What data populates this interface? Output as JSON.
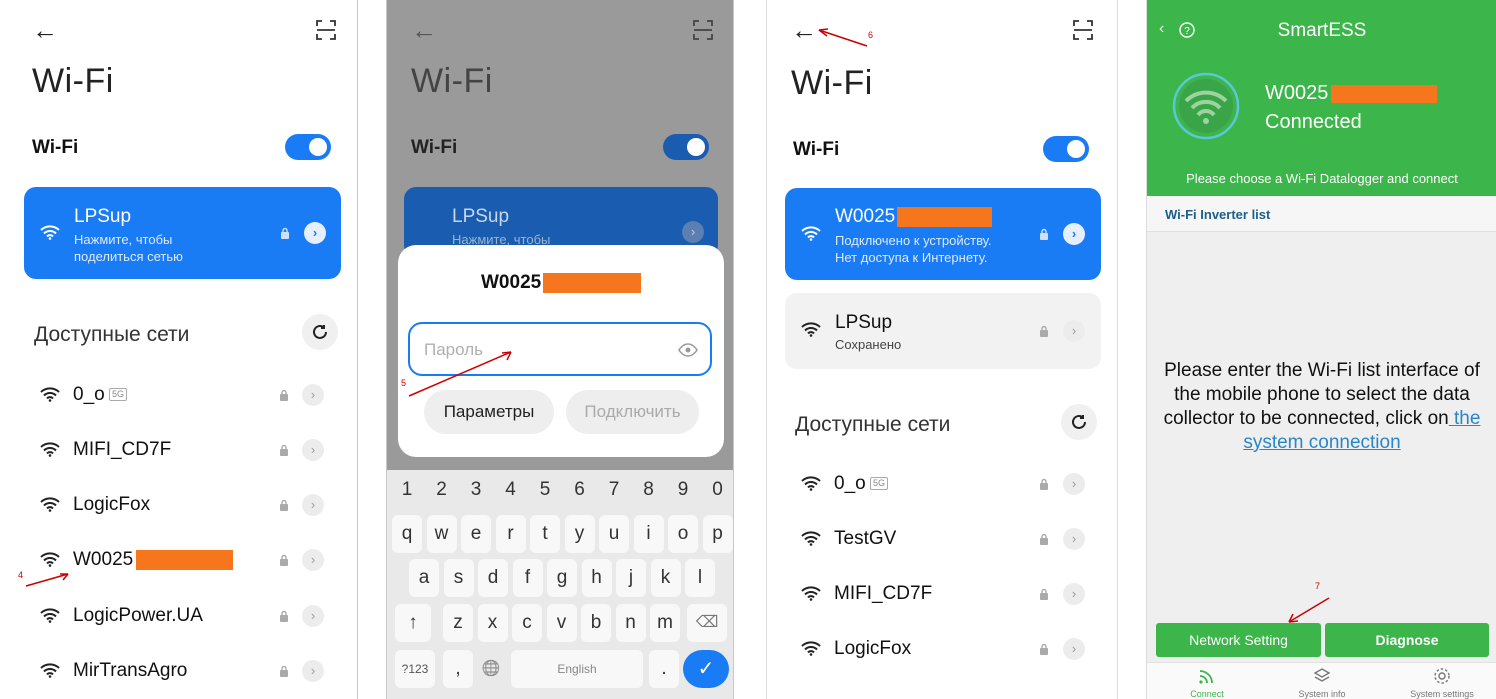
{
  "screen1": {
    "title": "Wi-Fi",
    "wifi_label": "Wi-Fi",
    "connected": {
      "name": "LPSup",
      "sub_line1": "Нажмите, чтобы",
      "sub_line2": "поделиться сетью"
    },
    "section_title": "Доступные сети",
    "networks": [
      {
        "name": "0_o",
        "badge": "5G"
      },
      {
        "name": "MIFI_CD7F"
      },
      {
        "name": "LogicFox"
      },
      {
        "name": "W0025"
      },
      {
        "name": "LogicPower.UA"
      },
      {
        "name": "MirTransAgro"
      }
    ],
    "step_label": "4"
  },
  "screen2": {
    "title": "Wi-Fi",
    "wifi_label": "Wi-Fi",
    "bg_card": {
      "name": "LPSup",
      "sub_line1": "Нажмите, чтобы"
    },
    "dialog": {
      "network_name": "W0025",
      "password_placeholder": "Пароль",
      "options_button": "Параметры",
      "connect_button": "Подключить"
    },
    "step_label": "5",
    "keyboard": {
      "numbers": [
        "1",
        "2",
        "3",
        "4",
        "5",
        "6",
        "7",
        "8",
        "9",
        "0"
      ],
      "row1": [
        "q",
        "w",
        "e",
        "r",
        "t",
        "y",
        "u",
        "i",
        "o",
        "p"
      ],
      "row2": [
        "a",
        "s",
        "d",
        "f",
        "g",
        "h",
        "j",
        "k",
        "l"
      ],
      "row3": [
        "z",
        "x",
        "c",
        "v",
        "b",
        "n",
        "m"
      ],
      "shift": "↑",
      "backspace": "⌫",
      "sym_key": "?123",
      "comma": ",",
      "globe": "🌐",
      "space_label": "English",
      "period": ".",
      "enter": "✓"
    }
  },
  "screen3": {
    "title": "Wi-Fi",
    "wifi_label": "Wi-Fi",
    "connected": {
      "name": "W0025",
      "sub_line1": "Подключено к устройству.",
      "sub_line2": "Нет доступа к Интернету."
    },
    "saved": {
      "name": "LPSup",
      "status": "Сохранено"
    },
    "section_title": "Доступные сети",
    "networks": [
      {
        "name": "0_o",
        "badge": "5G"
      },
      {
        "name": "TestGV"
      },
      {
        "name": "MIFI_CD7F"
      },
      {
        "name": "LogicFox"
      }
    ],
    "step_label": "6"
  },
  "screen4": {
    "app_title": "SmartESS",
    "device_name": "W0025",
    "status": "Connected",
    "choose_text": "Please choose a Wi-Fi Datalogger and connect",
    "list_title": "Wi-Fi Inverter list",
    "instructions_1": "Please enter the Wi-Fi list interface of the mobile phone to select the data collector to be connected, click on",
    "instructions_link": " the system connection",
    "network_setting_button": "Network Setting",
    "diagnose_button": "Diagnose",
    "nav": [
      {
        "label": "Connect"
      },
      {
        "label": "System info"
      },
      {
        "label": "System settings"
      }
    ],
    "step_label": "7",
    "colors": {
      "green": "#3cb54a",
      "link": "#2a86c6"
    }
  },
  "colors": {
    "accent_blue": "#1a7cf5",
    "redaction": "#f6761e",
    "annotation": "#cc0000"
  }
}
